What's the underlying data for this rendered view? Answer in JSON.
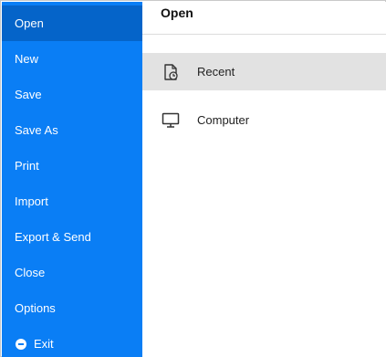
{
  "sidebar": {
    "items": [
      {
        "label": "Open"
      },
      {
        "label": "New"
      },
      {
        "label": "Save"
      },
      {
        "label": "Save As"
      },
      {
        "label": "Print"
      },
      {
        "label": "Import"
      },
      {
        "label": "Export & Send"
      },
      {
        "label": "Close"
      },
      {
        "label": "Options"
      },
      {
        "label": "Exit"
      }
    ],
    "active_item": "Open"
  },
  "content": {
    "title": "Open",
    "options": [
      {
        "label": "Recent",
        "icon": "recent-document-icon"
      },
      {
        "label": "Computer",
        "icon": "computer-icon"
      }
    ],
    "selected_option": "Recent"
  },
  "colors": {
    "sidebar_bg": "#0a7ef5",
    "sidebar_active_bg": "#0564c9",
    "selected_option_bg": "#e2e2e2"
  }
}
